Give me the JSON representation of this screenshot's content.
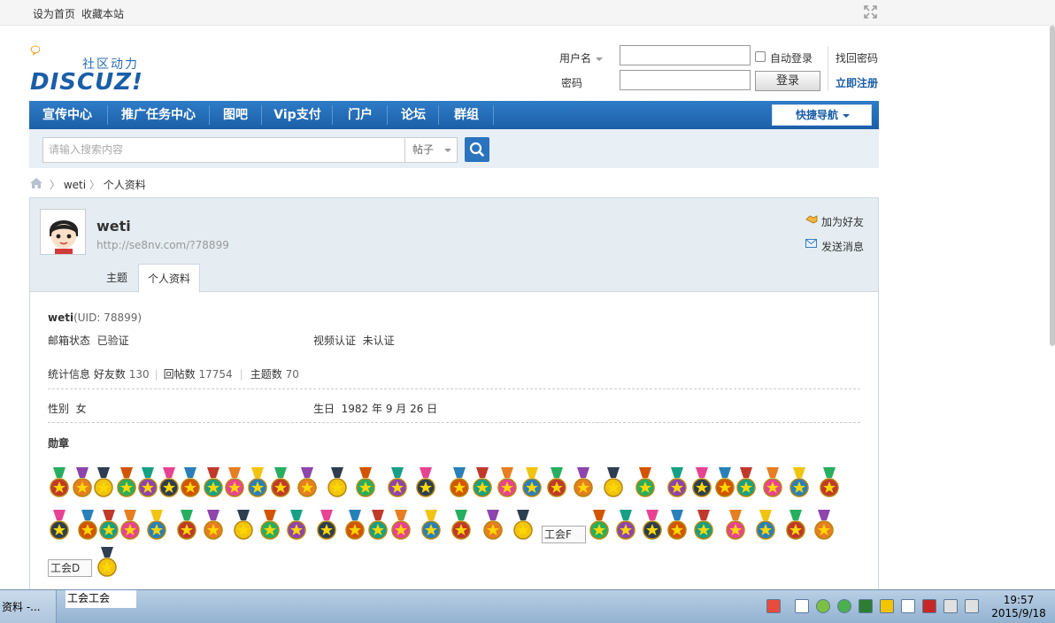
{
  "topbar": {
    "set_home": "设为首页",
    "bookmark": "收藏本站"
  },
  "logo": {
    "subtitle": "社区动力",
    "brand": "DISCUZ!"
  },
  "login": {
    "username_label": "用户名",
    "password_label": "密码",
    "auto_login": "自动登录",
    "submit": "登录",
    "find_password": "找回密码",
    "register": "立即注册"
  },
  "nav": {
    "items": [
      "宣传中心",
      "推广任务中心",
      "图吧",
      "Vip支付",
      "门户",
      "论坛",
      "群组"
    ],
    "quick_nav": "快捷导航"
  },
  "search": {
    "placeholder": "请输入搜索内容",
    "type": "帖子"
  },
  "breadcrumb": {
    "user": "weti",
    "page": "个人资料"
  },
  "profile": {
    "name": "weti",
    "url": "http://se8nv.com/?78899",
    "add_friend": "加为好友",
    "send_message": "发送消息",
    "tabs": [
      "主题",
      "个人资料"
    ],
    "uid_name": "weti",
    "uid_text": "(UID: 78899)",
    "email_label": "邮箱状态",
    "email_value": "已验证",
    "video_label": "视频认证",
    "video_value": "未认证",
    "stats_label": "统计信息",
    "friends_label": "好友数",
    "friends_value": "130",
    "replies_label": "回帖数",
    "replies_value": "17754",
    "topics_label": "主题数",
    "topics_value": "70",
    "gender_label": "性别",
    "gender_value": "女",
    "birthday_label": "生日",
    "birthday_value": "1982 年 9 月 26 日",
    "medals_label": "勋章",
    "medal_alt_1": "工会F",
    "medal_alt_2": "工会D"
  },
  "taskbar": {
    "task1": "资料 -...",
    "task2": "工会工会",
    "time": "19:57",
    "date": "2015/9/18"
  }
}
